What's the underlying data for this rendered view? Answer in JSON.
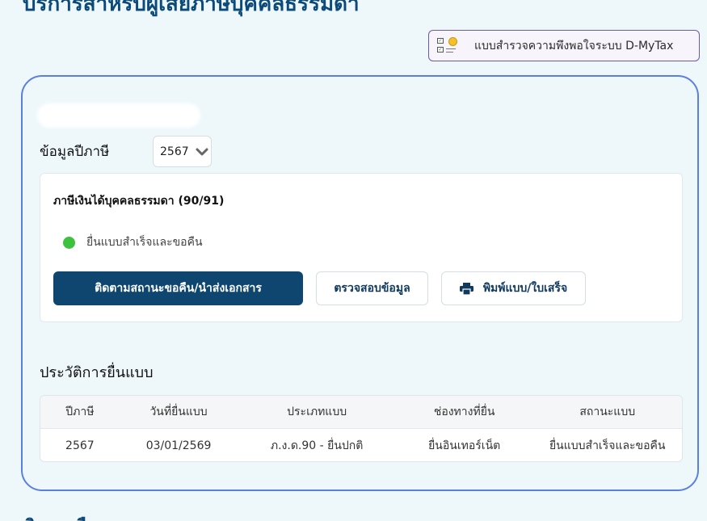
{
  "page": {
    "heading": "บริการสำหรับผู้เสียภาษีบุคคลธรรมดา",
    "bottom_heading": "ติดตามคืน"
  },
  "survey": {
    "label": "แบบสำรวจความพึงพอใจระบบ D-MyTax",
    "icon": "survey-icon"
  },
  "year_info": {
    "label": "ข้อมูลปีภาษี",
    "selected_year": "2567"
  },
  "tax_card": {
    "title": "ภาษีเงินได้บุคคลธรรมดา (90/91)",
    "status_text": "ยื่นแบบสำเร็จและขอคืน",
    "status_color": "#3cc23c",
    "buttons": {
      "track": "ติดตามสถานะขอคืน/นำส่งเอกสาร",
      "verify": "ตรวจสอบข้อมูล",
      "print": "พิมพ์แบบ/ใบเสร็จ"
    }
  },
  "history": {
    "title": "ประวัติการยื่นแบบ",
    "columns": [
      "ปีภาษี",
      "วันที่ยื่นแบบ",
      "ประเภทแบบ",
      "ช่องทางที่ยื่น",
      "สถานะแบบ"
    ],
    "rows": [
      [
        "2567",
        "03/01/2569",
        "ภ.ง.ด.90 - ยื่นปกติ",
        "ยื่นอินเทอร์เน็ต",
        "ยื่นแบบสำเร็จและขอคืน"
      ]
    ]
  },
  "colors": {
    "primary": "#0f4670",
    "card_border": "#5b7fe0",
    "background": "#eef8fb"
  }
}
